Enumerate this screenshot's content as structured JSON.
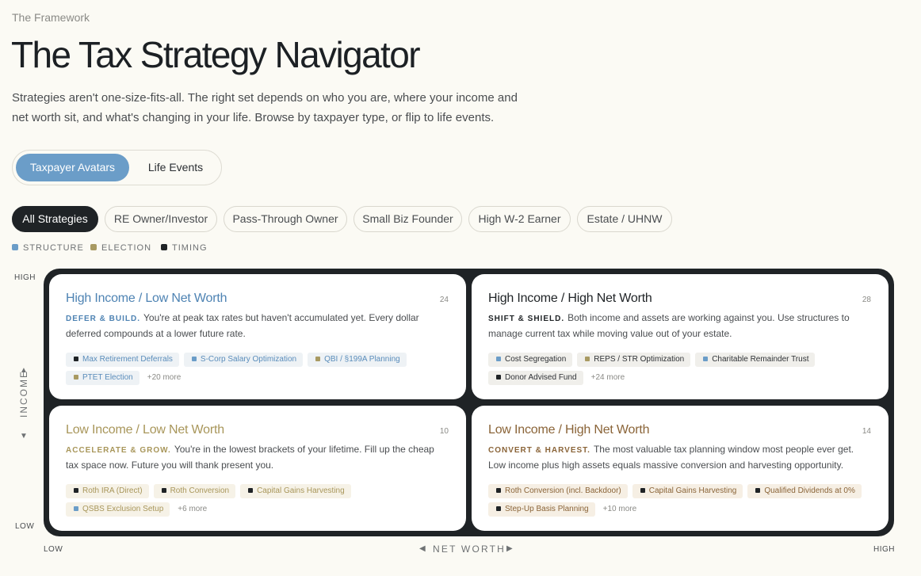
{
  "eyebrow": "The Framework",
  "title": "The Tax Strategy Navigator",
  "intro": "Strategies aren't one-size-fits-all. The right set depends on who you are, where your income and net worth sit, and what's changing in your life. Browse by taxpayer type, or flip to life events.",
  "view_toggle": {
    "active": "Taxpayer Avatars",
    "inactive": "Life Events"
  },
  "filters": [
    "All Strategies",
    "RE Owner/Investor",
    "Pass-Through Owner",
    "Small Biz Founder",
    "High W-2 Earner",
    "Estate / UHNW"
  ],
  "legend": [
    {
      "label": "STRUCTURE",
      "color": "#6b9dc8"
    },
    {
      "label": "ELECTION",
      "color": "#a89a62"
    },
    {
      "label": "TIMING",
      "color": "#1f2326"
    }
  ],
  "axes": {
    "y_high": "HIGH",
    "y_low": "LOW",
    "y_label": "INCOME",
    "x_low": "LOW",
    "x_high": "HIGH",
    "x_label": "NET WORTH"
  },
  "quadrants": [
    {
      "title": "High Income / Low Net Worth",
      "count": "24",
      "tag": "DEFER & BUILD.",
      "desc": "You're at peak tax rates but haven't accumulated yet. Every dollar deferred compounds at a lower future rate.",
      "pills": [
        {
          "label": "Max Retirement Deferrals",
          "color": "#1f2326"
        },
        {
          "label": "S-Corp Salary Optimization",
          "color": "#6b9dc8"
        },
        {
          "label": "QBI / §199A Planning",
          "color": "#a89a62"
        },
        {
          "label": "PTET Election",
          "color": "#a89a62"
        }
      ],
      "more": "+20 more"
    },
    {
      "title": "High Income / High Net Worth",
      "count": "28",
      "tag": "SHIFT & SHIELD.",
      "desc": "Both income and assets are working against you. Use structures to manage current tax while moving value out of your estate.",
      "pills": [
        {
          "label": "Cost Segregation",
          "color": "#6b9dc8"
        },
        {
          "label": "REPS / STR Optimization",
          "color": "#a89a62"
        },
        {
          "label": "Charitable Remainder Trust",
          "color": "#6b9dc8"
        },
        {
          "label": "Donor Advised Fund",
          "color": "#1f2326"
        }
      ],
      "more": "+24 more"
    },
    {
      "title": "Low Income / Low Net Worth",
      "count": "10",
      "tag": "ACCELERATE & GROW.",
      "desc": "You're in the lowest brackets of your lifetime. Fill up the cheap tax space now. Future you will thank present you.",
      "pills": [
        {
          "label": "Roth IRA (Direct)",
          "color": "#1f2326"
        },
        {
          "label": "Roth Conversion",
          "color": "#1f2326"
        },
        {
          "label": "Capital Gains Harvesting",
          "color": "#1f2326"
        },
        {
          "label": "QSBS Exclusion Setup",
          "color": "#6b9dc8"
        }
      ],
      "more": "+6 more"
    },
    {
      "title": "Low Income / High Net Worth",
      "count": "14",
      "tag": "CONVERT & HARVEST.",
      "desc": "The most valuable tax planning window most people ever get. Low income plus high assets equals massive conversion and harvesting opportunity.",
      "pills": [
        {
          "label": "Roth Conversion (incl. Backdoor)",
          "color": "#1f2326"
        },
        {
          "label": "Capital Gains Harvesting",
          "color": "#1f2326"
        },
        {
          "label": "Qualified Dividends at 0%",
          "color": "#1f2326"
        },
        {
          "label": "Step-Up Basis Planning",
          "color": "#1f2326"
        }
      ],
      "more": "+10 more"
    }
  ]
}
